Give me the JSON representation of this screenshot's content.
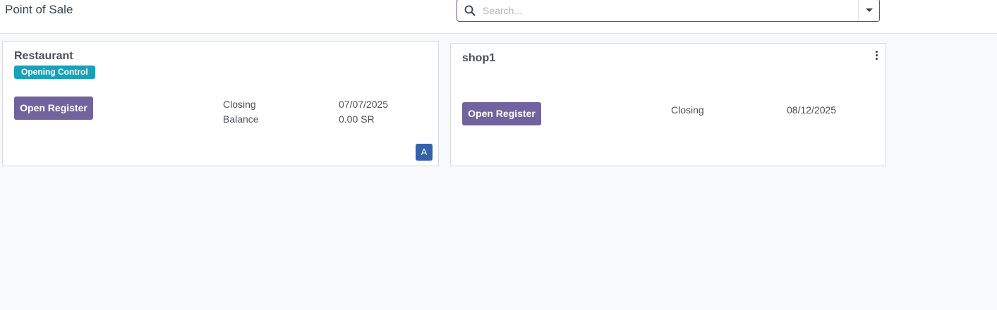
{
  "header": {
    "title": "Point of Sale",
    "search": {
      "placeholder": "Search...",
      "value": ""
    }
  },
  "cards": [
    {
      "name": "Restaurant",
      "badge": "Opening Control",
      "button": "Open Register",
      "closing_label": "Closing",
      "closing_date": "07/07/2025",
      "balance_label": "Balance",
      "balance_value": "0.00 SR",
      "avatar": "A"
    },
    {
      "name": "shop1",
      "button": "Open Register",
      "closing_label": "Closing",
      "closing_date": "08/12/2025"
    }
  ],
  "icons": {
    "search": "search-icon",
    "dropdown": "chevron-down-icon",
    "menu": "kebab-menu-icon"
  },
  "colors": {
    "primary_button": "#71639e",
    "badge": "#17a2b8",
    "avatar": "#3461a8",
    "search_border": "#714b67"
  }
}
